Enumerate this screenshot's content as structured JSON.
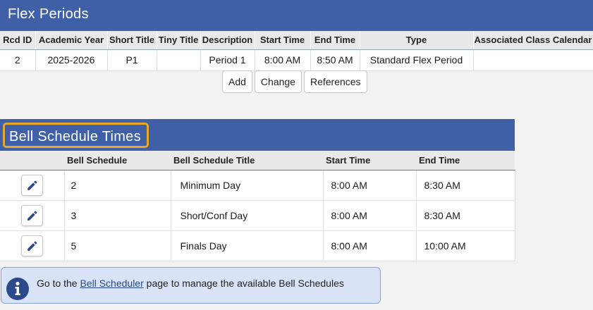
{
  "flex_periods": {
    "title": "Flex Periods",
    "columns": [
      "Rcd ID",
      "Academic Year",
      "Short Title",
      "Tiny Title",
      "Description",
      "Start Time",
      "End Time",
      "Type",
      "Associated Class Calendar"
    ],
    "row": {
      "rcd_id": "2",
      "academic_year": "2025-2026",
      "short_title": "P1",
      "tiny_title": "",
      "description": "Period 1",
      "start_time": "8:00 AM",
      "end_time": "8:50 AM",
      "type": "Standard Flex Period",
      "associated_class_calendar": ""
    },
    "buttons": {
      "add": "Add",
      "change": "Change",
      "references": "References"
    }
  },
  "bell_schedule_times": {
    "title": "Bell Schedule Times",
    "columns": [
      "",
      "Bell Schedule",
      "Bell Schedule Title",
      "Start Time",
      "End Time"
    ],
    "rows": [
      {
        "bell_schedule": "2",
        "title": "Minimum Day",
        "start_time": "8:00 AM",
        "end_time": "8:30 AM"
      },
      {
        "bell_schedule": "3",
        "title": "Short/Conf Day",
        "start_time": "8:00 AM",
        "end_time": "8:30 AM"
      },
      {
        "bell_schedule": "5",
        "title": "Finals Day",
        "start_time": "8:00 AM",
        "end_time": "10:00 AM"
      }
    ]
  },
  "info": {
    "prefix": "Go to the ",
    "link": "Bell Scheduler",
    "suffix": " page to manage the available Bell Schedules",
    "icon": "info-icon"
  },
  "colors": {
    "header_blue": "#3f5fa6",
    "highlight_border": "#e8a82a",
    "info_background": "#d9e3f7",
    "icon_blue": "#2b4a8c"
  }
}
